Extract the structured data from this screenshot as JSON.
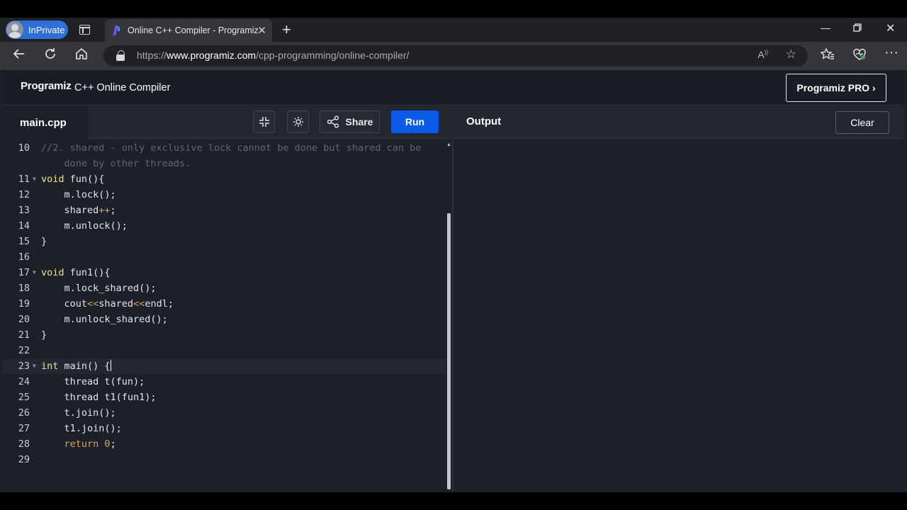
{
  "browser": {
    "profile_label": "InPrivate",
    "tab_title": "Online C++ Compiler - Programiz",
    "url_prefix": "https://",
    "url_domain": "www.programiz.com",
    "url_path": "/cpp-programming/online-compiler/"
  },
  "site": {
    "logo": "Programiz",
    "title": "C++ Online Compiler",
    "pro_button": "Programiz PRO ›"
  },
  "toolbar": {
    "file_tab": "main.cpp",
    "share_label": "Share",
    "run_label": "Run",
    "output_label": "Output",
    "clear_label": "Clear"
  },
  "editor": {
    "lines": [
      {
        "num": "10",
        "fold": false,
        "segments": [
          {
            "cls": "cm",
            "text": "//2. shared - only exclusive lock cannot be done but shared can be"
          }
        ]
      },
      {
        "num": "",
        "fold": false,
        "segments": [
          {
            "cls": "cm",
            "text": "    done by other threads."
          }
        ]
      },
      {
        "num": "11",
        "fold": true,
        "segments": [
          {
            "cls": "kw",
            "text": "void"
          },
          {
            "cls": "",
            "text": " fun(){"
          }
        ]
      },
      {
        "num": "12",
        "fold": false,
        "segments": [
          {
            "cls": "",
            "text": "    m.lock();"
          }
        ]
      },
      {
        "num": "13",
        "fold": false,
        "segments": [
          {
            "cls": "",
            "text": "    shared"
          },
          {
            "cls": "op",
            "text": "++"
          },
          {
            "cls": "",
            "text": ";"
          }
        ]
      },
      {
        "num": "14",
        "fold": false,
        "segments": [
          {
            "cls": "",
            "text": "    m.unlock();"
          }
        ]
      },
      {
        "num": "15",
        "fold": false,
        "segments": [
          {
            "cls": "",
            "text": "}"
          }
        ]
      },
      {
        "num": "16",
        "fold": false,
        "segments": []
      },
      {
        "num": "17",
        "fold": true,
        "segments": [
          {
            "cls": "kw",
            "text": "void"
          },
          {
            "cls": "",
            "text": " fun1(){"
          }
        ]
      },
      {
        "num": "18",
        "fold": false,
        "segments": [
          {
            "cls": "",
            "text": "    m.lock_shared();"
          }
        ]
      },
      {
        "num": "19",
        "fold": false,
        "segments": [
          {
            "cls": "",
            "text": "    cout"
          },
          {
            "cls": "op",
            "text": "<<"
          },
          {
            "cls": "",
            "text": "shared"
          },
          {
            "cls": "op",
            "text": "<<"
          },
          {
            "cls": "",
            "text": "endl;"
          }
        ]
      },
      {
        "num": "20",
        "fold": false,
        "segments": [
          {
            "cls": "",
            "text": "    m.unlock_shared();"
          }
        ]
      },
      {
        "num": "21",
        "fold": false,
        "segments": [
          {
            "cls": "",
            "text": "}"
          }
        ]
      },
      {
        "num": "22",
        "fold": false,
        "segments": []
      },
      {
        "num": "23",
        "fold": true,
        "active": true,
        "segments": [
          {
            "cls": "kw",
            "text": "int"
          },
          {
            "cls": "",
            "text": " main() {"
          }
        ]
      },
      {
        "num": "24",
        "fold": false,
        "segments": [
          {
            "cls": "",
            "text": "    thread t(fun);"
          }
        ]
      },
      {
        "num": "25",
        "fold": false,
        "segments": [
          {
            "cls": "",
            "text": "    thread t1(fun1);"
          }
        ]
      },
      {
        "num": "26",
        "fold": false,
        "segments": [
          {
            "cls": "",
            "text": "    t.join();"
          }
        ]
      },
      {
        "num": "27",
        "fold": false,
        "segments": [
          {
            "cls": "",
            "text": "    t1.join();"
          }
        ]
      },
      {
        "num": "28",
        "fold": false,
        "segments": [
          {
            "cls": "op",
            "text": "    return"
          },
          {
            "cls": "",
            "text": " "
          },
          {
            "cls": "num",
            "text": "0"
          },
          {
            "cls": "",
            "text": ";"
          }
        ]
      },
      {
        "num": "29",
        "fold": false,
        "segments": []
      }
    ]
  },
  "colors": {
    "run_button": "#0b5be8",
    "keyword": "#f0e39b",
    "operator": "#d7a260",
    "comment": "#5f6671"
  }
}
